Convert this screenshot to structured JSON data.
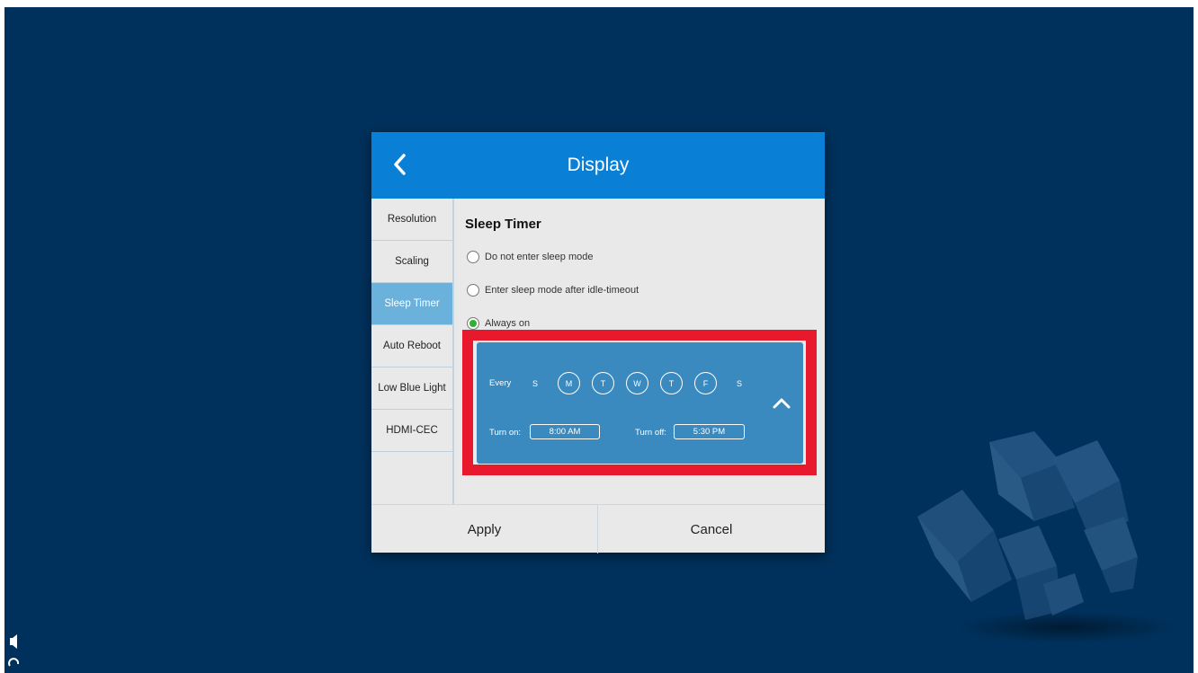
{
  "dialog": {
    "title": "Display"
  },
  "sidebar": {
    "items": [
      {
        "label": "Resolution"
      },
      {
        "label": "Scaling"
      },
      {
        "label": "Sleep Timer",
        "active": true
      },
      {
        "label": "Auto Reboot"
      },
      {
        "label": "Low Blue Light"
      },
      {
        "label": "HDMI-CEC"
      }
    ]
  },
  "content": {
    "section_title": "Sleep Timer",
    "options": [
      {
        "label": "Do not enter sleep mode",
        "selected": false
      },
      {
        "label": "Enter sleep mode after idle-timeout",
        "selected": false
      },
      {
        "label": "Always on",
        "selected": true
      }
    ]
  },
  "schedule": {
    "every_label": "Every",
    "days": [
      {
        "label": "S",
        "selected": false
      },
      {
        "label": "M",
        "selected": true
      },
      {
        "label": "T",
        "selected": true
      },
      {
        "label": "W",
        "selected": true
      },
      {
        "label": "T",
        "selected": true
      },
      {
        "label": "F",
        "selected": true
      },
      {
        "label": "S",
        "selected": false
      }
    ],
    "turn_on_label": "Turn on:",
    "turn_on_value": "8:00 AM",
    "turn_off_label": "Turn off:",
    "turn_off_value": "5:30 PM"
  },
  "footer": {
    "apply_label": "Apply",
    "cancel_label": "Cancel"
  },
  "colors": {
    "background": "#00315c",
    "header": "#0a7fd6",
    "active_tab": "#6ab1dc",
    "schedule_panel": "#3a89bf",
    "highlight": "#e8192c",
    "selected_radio": "#2fb32f"
  }
}
